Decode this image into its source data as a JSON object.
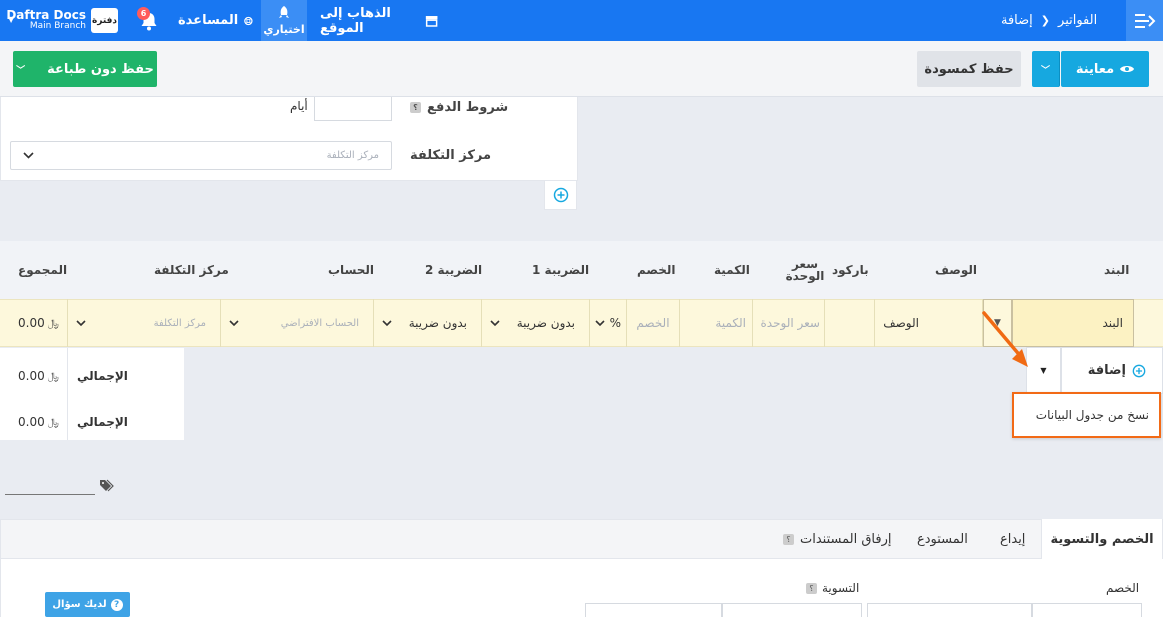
{
  "topbar": {
    "company_name": "Daftra Docs",
    "branch": "Main Branch",
    "logo_text": "دفترة",
    "notifications_count": "6",
    "help_label": "المساعدة",
    "optional_label": "اختياري",
    "goto_site_label": "الذهاب إلى الموقع",
    "breadcrumb": [
      "الفواتير",
      "إضافة"
    ]
  },
  "toolbar": {
    "save_no_print_label": "حفظ دون طباعة",
    "save_draft_label": "حفظ كمسودة",
    "preview_label": "معاينة"
  },
  "form": {
    "payment_terms_label": "شروط الدفع",
    "days_label": "أيام",
    "cost_center_label": "مركز التكلفة",
    "cost_center_placeholder": "مركز التكلفة"
  },
  "items_table": {
    "headers": {
      "item": "البند",
      "description": "الوصف",
      "barcode": "باركود",
      "unit_price": "سعر الوحدة",
      "quantity": "الكمية",
      "discount": "الخصم",
      "tax1": "الضريبة 1",
      "tax2": "الضريبة 2",
      "account": "الحساب",
      "cost_center": "مركز التكلفة",
      "total": "المجموع"
    },
    "row": {
      "item": "البند",
      "description": "الوصف",
      "unit_price_placeholder": "سعر الوحدة",
      "quantity_placeholder": "الكمية",
      "discount_placeholder": "الخصم",
      "discount_type": "%",
      "tax1": "بدون ضريبة",
      "tax2": "بدون ضريبة",
      "account_placeholder": "الحساب الافتراضي",
      "cost_center_placeholder": "مركز التكلفة",
      "total": "0.00"
    },
    "add_label": "إضافة",
    "dropdown_item": "نسخ من جدول البيانات",
    "totals": [
      {
        "label": "الإجمالي",
        "value": "0.00"
      },
      {
        "label": "الإجمالي",
        "value": "0.00"
      }
    ]
  },
  "tabs": [
    "الخصم والتسوية",
    "إيداع",
    "المستودع",
    "إرفاق المستندات"
  ],
  "bottom": {
    "discount_label": "الخصم",
    "settlement_label": "التسوية",
    "question_button": "لديك سؤال"
  },
  "colors": {
    "primary": "#1877f2",
    "success": "#1fb46a",
    "info": "#16a8e0",
    "highlight": "#ff6a13",
    "row": "#fdf8dc"
  }
}
